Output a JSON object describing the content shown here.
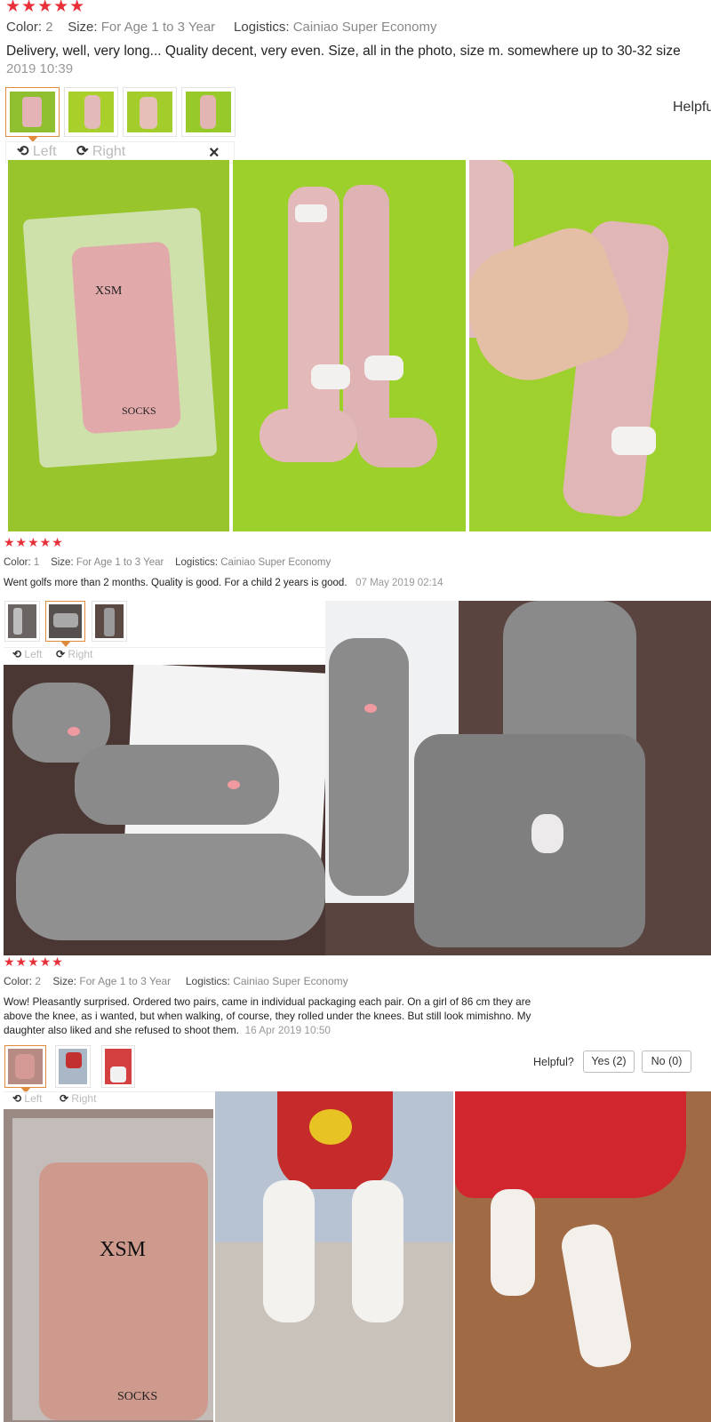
{
  "colors": {
    "star": "#e8303a",
    "accent": "#e08a3c"
  },
  "labels": {
    "color": "Color:",
    "size": "Size:",
    "logistics": "Logistics:",
    "rotate_left": "Left",
    "rotate_right": "Right",
    "helpful": "Helpful?",
    "helpful_cut": "Helpfu",
    "close": "×"
  },
  "reviews": [
    {
      "stars": "★★★★★",
      "color": "2",
      "size": "For Age 1 to 3 Year",
      "logistics": "Cainiao Super Economy",
      "text": "Delivery, well, very long... Quality decent, very even. Size, all in the photo, size m. somewhere up to 30-32 size",
      "date": "2019 10:39",
      "thumbnails": [
        "pink-socks-in-package",
        "pink-socks-on-green",
        "hand-on-sock",
        "sock-on-green"
      ],
      "photos": [
        "pink socks in package",
        "pair of pink fox socks",
        "hand measuring sock"
      ]
    },
    {
      "stars": "★★★★★",
      "color": "1",
      "size": "For Age 1 to 3 Year",
      "logistics": "Cainiao Super Economy",
      "text": "Went golfs more than 2 months. Quality is good. For a child 2 years is good.",
      "date": "07 May 2019 02:14",
      "thumbnails": [
        "grey-socks-package",
        "grey-socks-flat",
        "grey-socks-worn"
      ],
      "photos": [
        "grey socks with package",
        "grey sock detail"
      ]
    },
    {
      "stars": "★★★★★",
      "color": "2",
      "size": "For Age 1 to 3 Year",
      "logistics": "Cainiao Super Economy",
      "text_lines": [
        "Wow! Pleasantly surprised. Ordered two pairs, came in individual packaging each pair. On a girl of 86 cm they are",
        "above the knee, as i wanted, but when walking, of course, they rolled under the knees. But still look mimishno. My",
        "daughter also liked and she refused to shoot them."
      ],
      "date": "16 Apr 2019 10:50",
      "helpful_yes": "Yes (2)",
      "helpful_no": "No (0)",
      "thumbnails": [
        "pink-socks-package",
        "child-sitting",
        "child-standing"
      ],
      "photos": [
        "pink socks in bag XSM",
        "child sitting in white socks",
        "child standing in white socks"
      ]
    }
  ]
}
